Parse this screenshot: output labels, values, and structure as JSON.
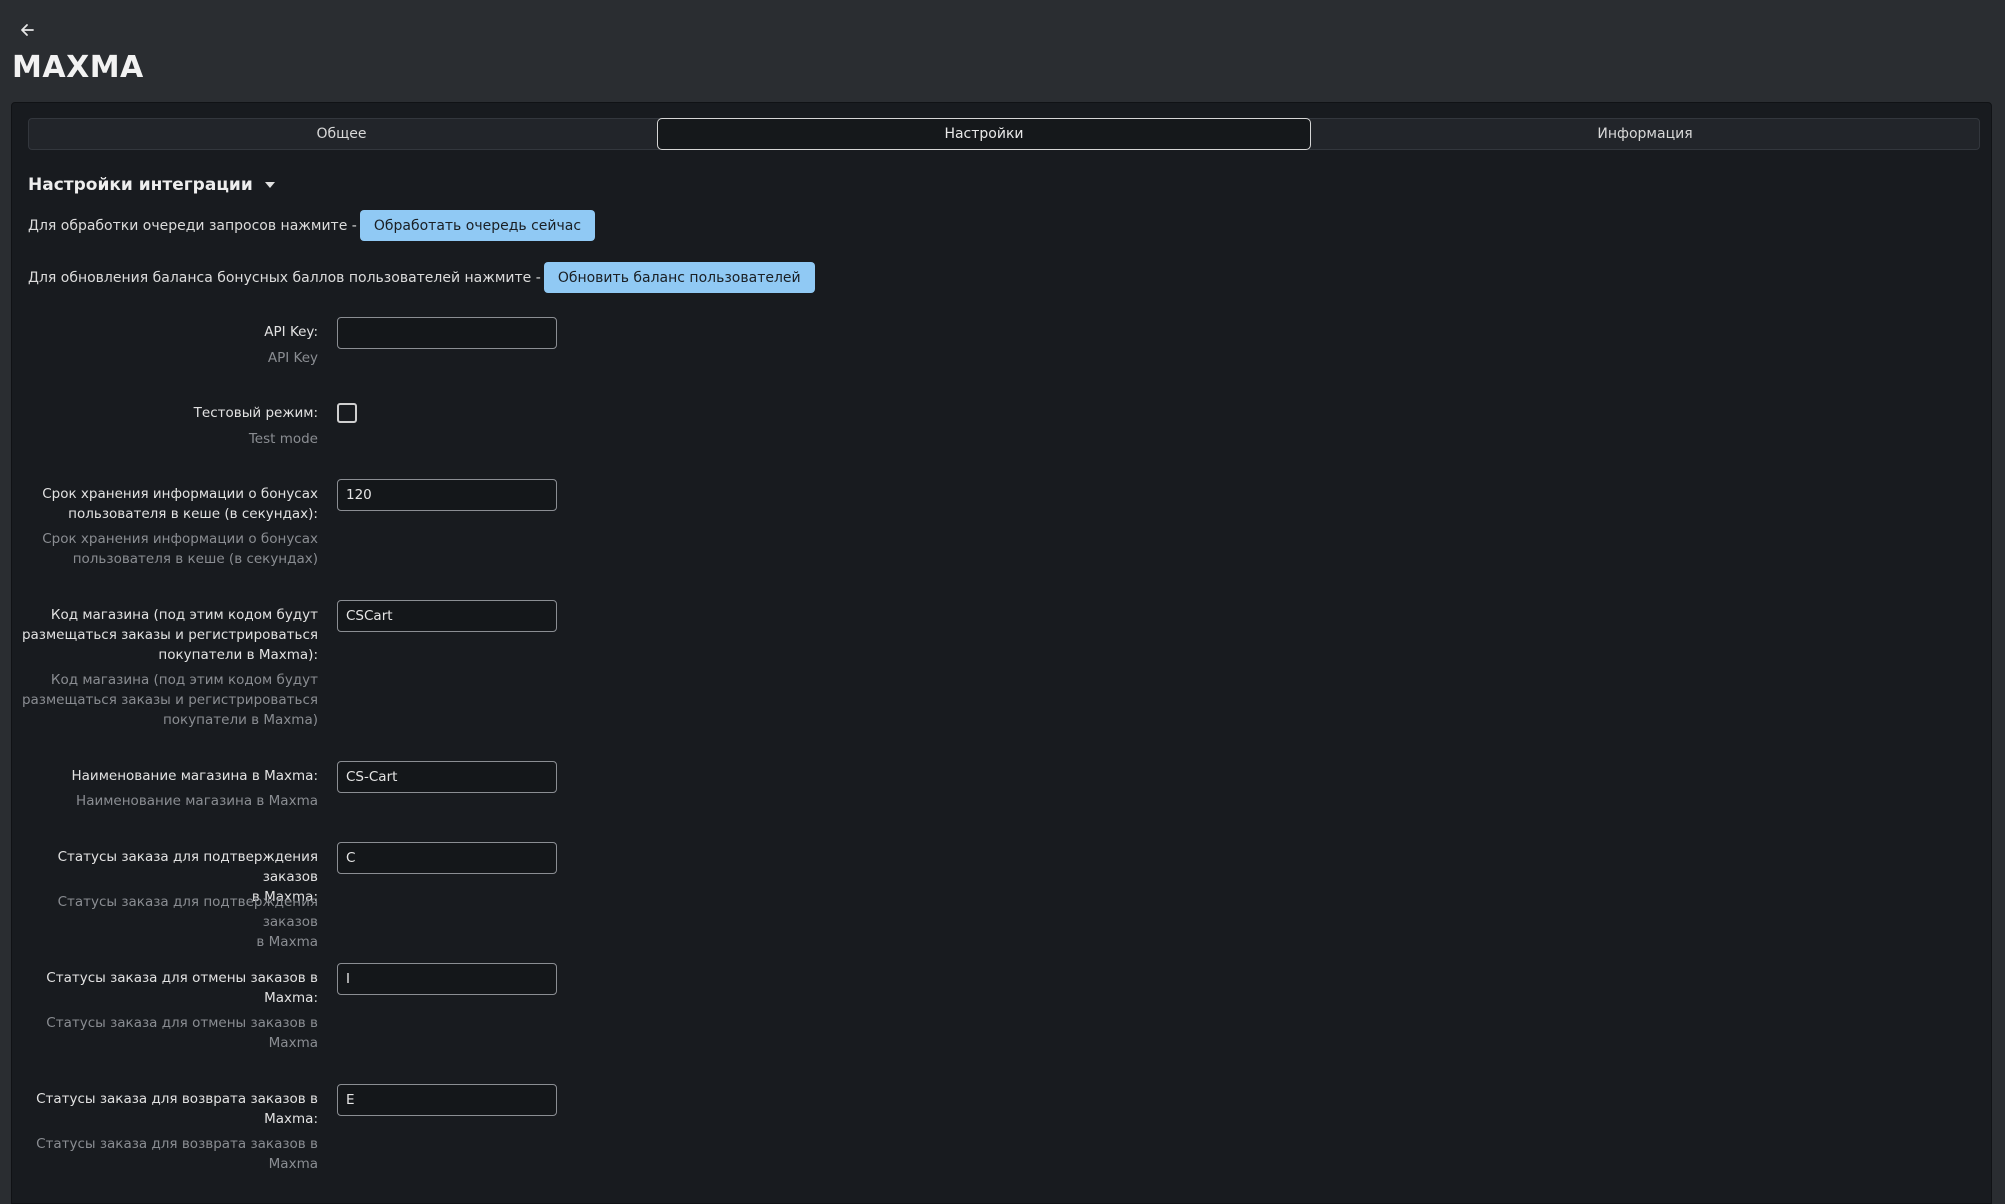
{
  "header": {
    "back_icon": "arrow-left-icon",
    "title": "MAXMA"
  },
  "tabs": [
    {
      "label": "Общее",
      "active": false
    },
    {
      "label": "Настройки",
      "active": true
    },
    {
      "label": "Информация",
      "active": false
    }
  ],
  "section": {
    "title": "Настройки интеграции",
    "caret_icon": "caret-down-icon"
  },
  "actions": {
    "queue_text": "Для обработки очереди запросов нажмите -",
    "queue_button": "Обработать очередь сейчас",
    "balance_text": "Для обновления баланса бонусных баллов пользователей нажмите -",
    "balance_button": "Обновить баланс пользователей"
  },
  "fields": {
    "api_key": {
      "label": "API Key:",
      "hint": "API Key",
      "value": ""
    },
    "test_mode": {
      "label": "Тестовый режим:",
      "hint": "Test mode",
      "checked": false
    },
    "cache_ttl": {
      "label_1": "Срок хранения информации о бонусах",
      "label_2": "пользователя в кеше (в секундах):",
      "hint_1": "Срок хранения информации о бонусах",
      "hint_2": "пользователя в кеше (в секундах)",
      "value": "120"
    },
    "shop_code": {
      "label_1": "Код магазина (под этим кодом будут",
      "label_2": "размещаться заказы и регистрироваться",
      "label_3": "покупатели в Maxma):",
      "hint_1": "Код магазина (под этим кодом будут",
      "hint_2": "размещаться заказы и регистрироваться",
      "hint_3": "покупатели в Maxma)",
      "value": "CSCart"
    },
    "shop_name": {
      "label": "Наименование магазина в Maxma:",
      "hint": "Наименование магазина в Maxma",
      "value": "CS-Cart"
    },
    "confirm_statuses": {
      "label_1": "Статусы заказа для подтверждения заказов",
      "label_2": "в Maxma:",
      "hint_1": "Статусы заказа для подтверждения заказов",
      "hint_2": "в Maxma",
      "value": "C"
    },
    "cancel_statuses": {
      "label_1": "Статусы заказа для отмены заказов в",
      "label_2": "Maxma:",
      "hint_1": "Статусы заказа для отмены заказов в",
      "hint_2": "Maxma",
      "value": "I"
    },
    "return_statuses": {
      "label_1": "Статусы заказа для возврата заказов в",
      "label_2": "Maxma:",
      "hint_1": "Статусы заказа для возврата заказов в",
      "hint_2": "Maxma",
      "value": "E"
    }
  },
  "colors": {
    "primary_button": "#90c9f4",
    "background": "#181b1f",
    "header": "#2a2d31"
  }
}
